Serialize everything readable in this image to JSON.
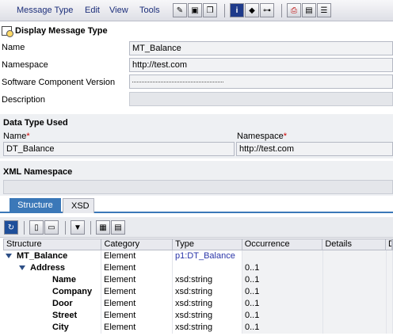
{
  "menu": [
    "Message Type",
    "Edit",
    "View",
    "Tools"
  ],
  "toolbar_icons": [
    "pencil-icon",
    "save-icon",
    "copy-icon",
    "info-icon",
    "object-icon",
    "tree-icon",
    "print-icon",
    "display-icon",
    "help-icon"
  ],
  "title": "Display Message Type",
  "fields": {
    "name_label": "Name",
    "name_value": "MT_Balance",
    "namespace_label": "Namespace",
    "namespace_value": "http://test.com",
    "swcv_label": "Software Component Version",
    "swcv_value": "",
    "description_label": "Description",
    "description_value": ""
  },
  "data_type_used": {
    "title": "Data Type Used",
    "name_label": "Name",
    "name_value": "DT_Balance",
    "namespace_label": "Namespace",
    "namespace_value": "http://test.com"
  },
  "xml_namespace": {
    "title": "XML Namespace",
    "value": ""
  },
  "tabs": [
    "Structure",
    "XSD"
  ],
  "tree": {
    "columns": [
      "Structure",
      "Category",
      "Type",
      "Occurrence",
      "Details",
      "D"
    ],
    "rows": [
      {
        "structure": "MT_Balance",
        "category": "Element",
        "type": "p1:DT_Balance",
        "occurrence": ""
      },
      {
        "structure": "Address",
        "category": "Element",
        "type": "",
        "occurrence": "0..1"
      },
      {
        "structure": "Name",
        "category": "Element",
        "type": "xsd:string",
        "occurrence": "0..1"
      },
      {
        "structure": "Company",
        "category": "Element",
        "type": "xsd:string",
        "occurrence": "0..1"
      },
      {
        "structure": "Door",
        "category": "Element",
        "type": "xsd:string",
        "occurrence": "0..1"
      },
      {
        "structure": "Street",
        "category": "Element",
        "type": "xsd:string",
        "occurrence": "0..1"
      },
      {
        "structure": "City",
        "category": "Element",
        "type": "xsd:string",
        "occurrence": "0..1"
      }
    ]
  }
}
